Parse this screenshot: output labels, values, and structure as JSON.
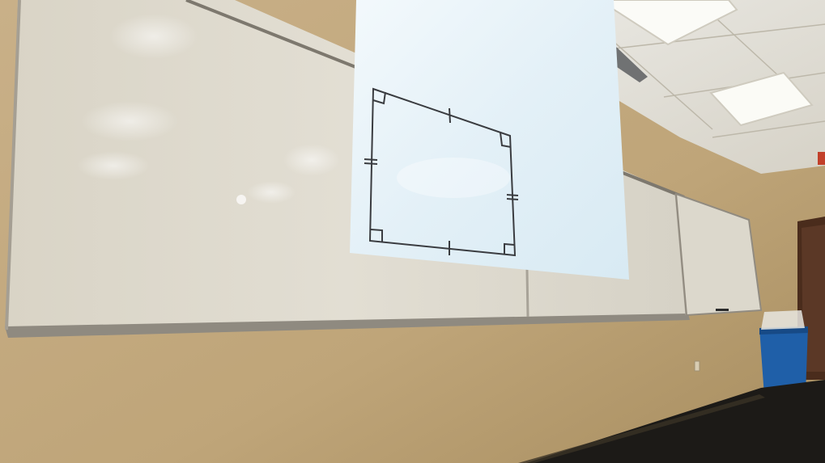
{
  "scene": {
    "description_free": true,
    "colors": {
      "wall": "#c2a97e",
      "wall_dark": "#a88f63",
      "ceiling": "#e6e4dc",
      "ceiling_light": "#ffffff",
      "whiteboard": "#dedbd0",
      "whiteboard_frame": "#8f8a80",
      "projection": "#e6f2f8",
      "drawing_stroke": "#3a3c40",
      "floor": "#1c1a17",
      "bin": "#1f5fa8",
      "door": "#4a2c1c"
    },
    "icons": [
      "ceiling-light-panel",
      "air-vent",
      "whiteboard",
      "projected-screen",
      "recycling-bin",
      "door",
      "exit-sign"
    ]
  }
}
